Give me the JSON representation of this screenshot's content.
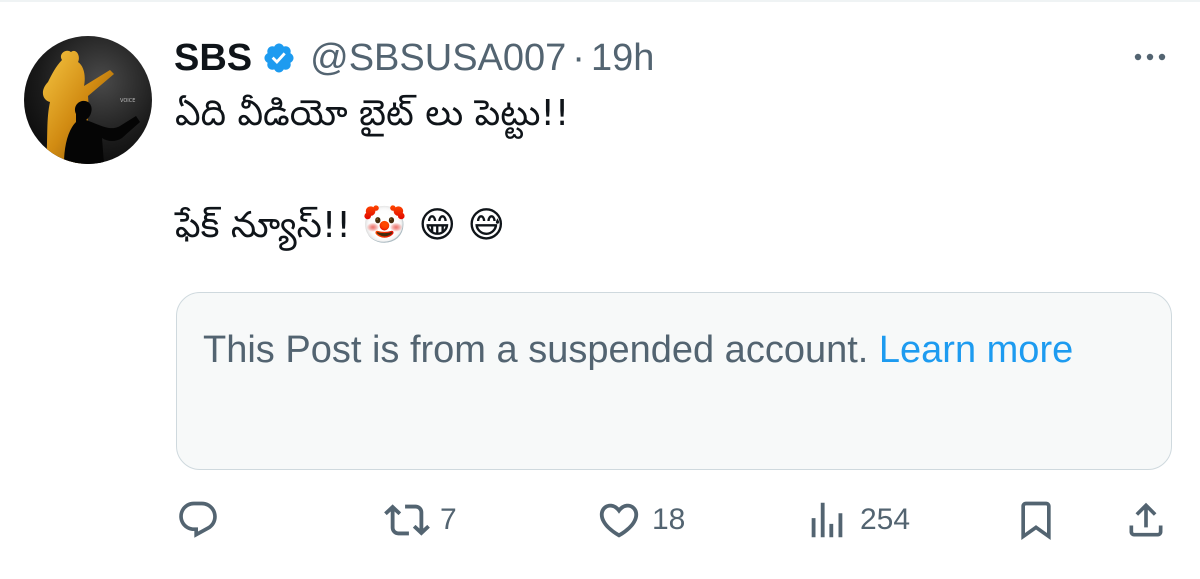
{
  "tweet": {
    "author_name": "SBS",
    "handle": "@SBSUSA007",
    "separator": "·",
    "time": "19h",
    "lines": [
      "ఏది వీడియో బైట్ లు పెట్టు!!",
      "",
      "ఫేక్ న్యూస్!! 🤡 😁 😅"
    ]
  },
  "notice": {
    "text": "This Post is from a suspended account. ",
    "link": "Learn more"
  },
  "actions": {
    "reply_count": "",
    "repost_count": "7",
    "like_count": "18",
    "views_count": "254"
  },
  "colors": {
    "accent": "#1d9bf0",
    "secondary_text": "#536471",
    "primary_text": "#0f1419",
    "notice_bg": "#f7f9f9",
    "border": "#cfd9de"
  },
  "icons": [
    "verified-badge-icon",
    "more-icon",
    "reply-icon",
    "repost-icon",
    "like-icon",
    "views-icon",
    "bookmark-icon",
    "share-icon"
  ]
}
